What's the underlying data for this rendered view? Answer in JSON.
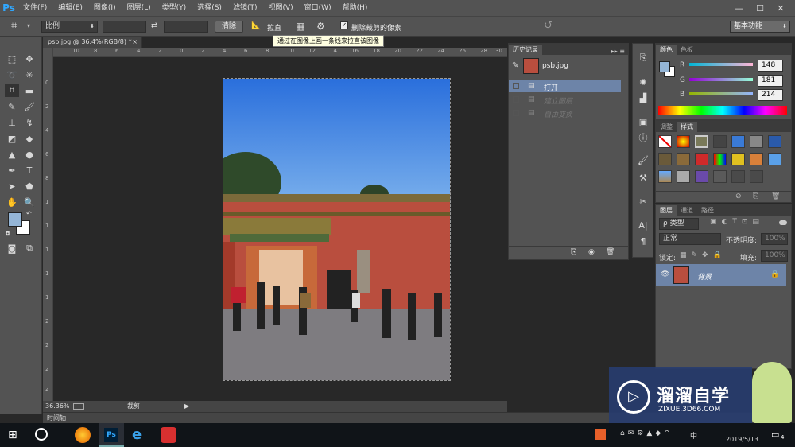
{
  "app": {
    "logo": "Ps"
  },
  "menu": [
    "文件(F)",
    "编辑(E)",
    "图像(I)",
    "图层(L)",
    "类型(Y)",
    "选择(S)",
    "滤镜(T)",
    "视图(V)",
    "窗口(W)",
    "帮助(H)"
  ],
  "window_buttons": [
    "—",
    "☐",
    "✕"
  ],
  "options": {
    "ratio_select": "比例",
    "clear_button": "清除",
    "straighten_label": "拉直",
    "delete_cropped_label": "删除裁剪的像素",
    "delete_cropped_checked": true,
    "workspace": "基本功能"
  },
  "tooltip": "通过在图像上画一条线来拉直该图像",
  "doc_tab": {
    "title": "psb.jpg @ 36.4%(RGB/8) *",
    "close": "×"
  },
  "ruler_top_ticks": [
    "10",
    "8",
    "6",
    "4",
    "2",
    "0",
    "2",
    "4",
    "6",
    "8",
    "10",
    "12",
    "14",
    "16",
    "18",
    "20",
    "22",
    "24",
    "26",
    "28",
    "30"
  ],
  "ruler_left_ticks": [
    "0",
    "2",
    "4",
    "6",
    "8",
    "1",
    "1",
    "1",
    "1",
    "1",
    "2",
    "2",
    "2",
    "2"
  ],
  "status": {
    "zoom": "36.36%",
    "tool": "裁剪"
  },
  "timeline": {
    "label": "时间轴"
  },
  "history": {
    "tab": "历史记录",
    "snapshot_name": "psb.jpg",
    "items": [
      "打开",
      "建立图层",
      "自由变换"
    ],
    "active_index": 0
  },
  "color": {
    "tabs": [
      "颜色",
      "色板"
    ],
    "r_label": "R",
    "g_label": "G",
    "b_label": "B",
    "r": "148",
    "g": "181",
    "b": "214",
    "fg_hex": "#94b5d6"
  },
  "styles": {
    "tabs": [
      "调整",
      "样式"
    ],
    "active": "样式"
  },
  "layers": {
    "tabs": [
      "图层",
      "通道",
      "路径"
    ],
    "filter_kind": "ρ 类型",
    "blend_mode": "正常",
    "opacity_label": "不透明度:",
    "opacity_value": "100%",
    "lock_label": "锁定:",
    "fill_label": "填充:",
    "fill_value": "100%",
    "layer_name": "背景"
  },
  "watermark": {
    "title": "溜溜自学",
    "url": "ZIXUE.3D66.COM"
  },
  "taskbar": {
    "date": "2019/5/13",
    "notif_count": "4",
    "ime": "中"
  }
}
